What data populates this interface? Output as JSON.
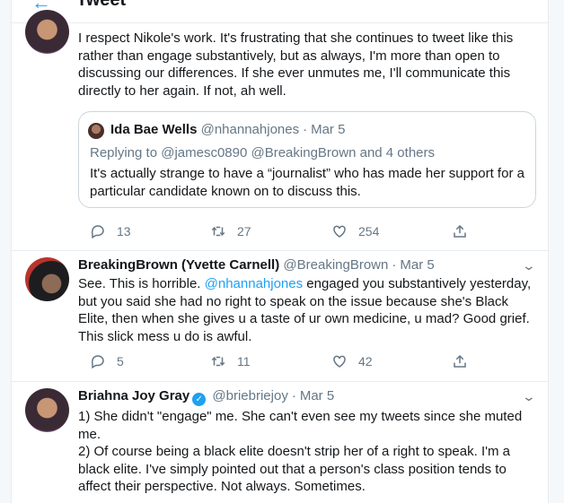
{
  "header": {
    "back_icon": "back-arrow-icon",
    "title": "Tweet"
  },
  "tweets": [
    {
      "display_name": "",
      "text": "I respect Nikole's work. It's frustrating that she continues to tweet like this rather than engage substantively, but as always, I'm more than open to discussing our differences. If she ever unmutes me, I'll communicate this directly to her again. If not, ah well.",
      "quote": {
        "display_name": "Ida Bae Wells",
        "handle": "@nhannahjones",
        "time": "Mar 5",
        "replying_to": "Replying to @jamesc0890 @BreakingBrown and 4 others",
        "text": "It's actually strange to have a “journalist” who has made her support for a particular candidate known on to discuss this."
      },
      "replies": "13",
      "retweets": "27",
      "likes": "254"
    },
    {
      "display_name": "BreakingBrown (Yvette Carnell)",
      "handle": "@BreakingBrown",
      "time": "Mar 5",
      "text_parts": {
        "a": "See. This is horrible. ",
        "mention": "@nhannahjones",
        "b": " engaged you substantively yesterday, but you said she had no right to speak on the issue because she's Black Elite, then when she gives u a taste of ur own medicine, u mad? Good grief. This slick mess u do is awful."
      },
      "replies": "5",
      "retweets": "11",
      "likes": "42"
    },
    {
      "display_name": "Briahna Joy Gray",
      "handle": "@briebriejoy",
      "time": "Mar 5",
      "text": "1) She didn't \"engage\" me. She can't even see my tweets since she muted me.\n2) Of course being a black elite doesn't strip her of a right to speak. I'm a black elite. I've simply pointed out that a person's class position tends to affect their perspective. Not always. Sometimes."
    }
  ],
  "colors": {
    "accent": "#1da1f2",
    "muted": "#657786",
    "text": "#14171a",
    "border": "#e6ecf0"
  }
}
